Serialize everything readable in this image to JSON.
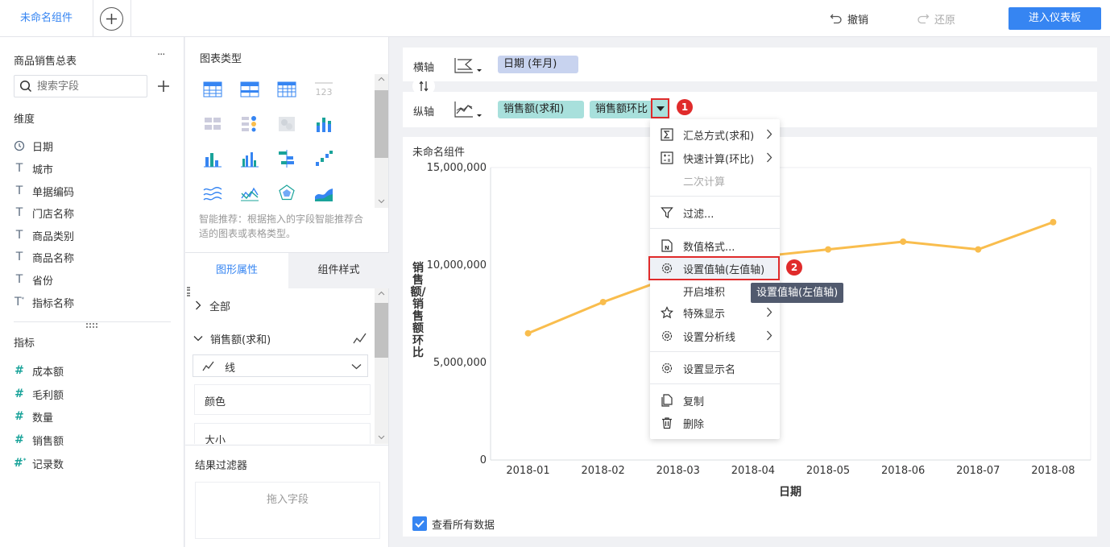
{
  "topbar": {
    "tab_title": "未命名组件",
    "undo_label": "撤销",
    "redo_label": "还原",
    "enter_dashboard_label": "进入仪表板"
  },
  "left_panel": {
    "dataset_title": "商品销售总表",
    "more_label": "···",
    "search_placeholder": "搜索字段",
    "dimension_title": "维度",
    "dimensions": [
      {
        "label": "日期",
        "icon": "clock-icon"
      },
      {
        "label": "城市",
        "icon": "text-type-icon"
      },
      {
        "label": "单据编码",
        "icon": "text-type-icon"
      },
      {
        "label": "门店名称",
        "icon": "text-type-icon"
      },
      {
        "label": "商品类别",
        "icon": "text-type-icon"
      },
      {
        "label": "商品名称",
        "icon": "text-type-icon"
      },
      {
        "label": "省份",
        "icon": "text-type-icon"
      },
      {
        "label": "指标名称",
        "icon": "text-type-calc-icon"
      }
    ],
    "measure_title": "指标",
    "measures": [
      {
        "label": "成本额",
        "icon": "hash-icon"
      },
      {
        "label": "毛利额",
        "icon": "hash-icon"
      },
      {
        "label": "数量",
        "icon": "hash-icon"
      },
      {
        "label": "销售额",
        "icon": "hash-icon"
      },
      {
        "label": "记录数",
        "icon": "hash-calc-icon"
      }
    ]
  },
  "middle_panel": {
    "chart_type_title": "图表类型",
    "smart_tip": "智能推荐：根据拖入的字段智能推荐合适的图表或表格类型。",
    "tabs": [
      "图形属性",
      "组件样式"
    ],
    "all_label": "全部",
    "series_label": "销售额(求和)",
    "mark_type": "线",
    "color_label": "颜色",
    "size_label": "大小",
    "result_filter_title": "结果过滤器",
    "drop_placeholder": "拖入字段"
  },
  "shelves": {
    "x_label": "横轴",
    "y_label": "纵轴",
    "x_pill": "日期 (年月)",
    "y_pills": [
      "销售额(求和)",
      "销售额环比"
    ]
  },
  "chart": {
    "component_title": "未命名组件",
    "show_all_label": "查看所有数据"
  },
  "chart_data": {
    "type": "line",
    "categories": [
      "2018-01",
      "2018-02",
      "2018-03",
      "2018-04",
      "2018-05",
      "2018-06",
      "2018-07",
      "2018-08"
    ],
    "series": [
      {
        "name": "销售额(求和)",
        "values": [
          6500000,
          8100000,
          9500000,
          10400000,
          10800000,
          11200000,
          10800000,
          12200000
        ]
      }
    ],
    "y_ticks": [
      "15,000,000",
      "10,000,000",
      "5,000,000",
      "0"
    ],
    "ylim": [
      0,
      15000000
    ],
    "xlabel": "日期",
    "ylabel": "销售额/销售额环比",
    "color": "#f9bd4d"
  },
  "context_menu": {
    "items": [
      {
        "label": "汇总方式(求和)",
        "icon": "sigma-icon",
        "submenu": true,
        "enabled": true
      },
      {
        "label": "快速计算(环比)",
        "icon": "calculator-icon",
        "submenu": true,
        "enabled": true
      },
      {
        "label": "二次计算",
        "icon": "",
        "submenu": false,
        "enabled": false
      },
      {
        "label": "过滤...",
        "icon": "filter-icon",
        "submenu": false,
        "enabled": true
      },
      {
        "label": "数值格式...",
        "icon": "number-format-icon",
        "submenu": false,
        "enabled": true
      },
      {
        "label": "设置值轴(左值轴)",
        "icon": "gear-icon",
        "submenu": false,
        "enabled": true
      },
      {
        "label": "开启堆积",
        "icon": "",
        "submenu": false,
        "enabled": true
      },
      {
        "label": "特殊显示",
        "icon": "star-icon",
        "submenu": true,
        "enabled": true
      },
      {
        "label": "设置分析线",
        "icon": "gear-icon",
        "submenu": true,
        "enabled": true
      },
      {
        "label": "设置显示名",
        "icon": "gear-icon",
        "submenu": false,
        "enabled": true
      },
      {
        "label": "复制",
        "icon": "copy-icon",
        "submenu": false,
        "enabled": true
      },
      {
        "label": "删除",
        "icon": "trash-icon",
        "submenu": false,
        "enabled": true
      }
    ],
    "tooltip": "设置值轴(左值轴)"
  },
  "annotations": {
    "badge_1": "1",
    "badge_2": "2"
  },
  "colors": {
    "accent": "#3685f2",
    "pill_dim": "#c8d3ef",
    "pill_measure": "#a8e0dc",
    "line": "#f9bd4d",
    "highlight": "#e02b2b"
  }
}
